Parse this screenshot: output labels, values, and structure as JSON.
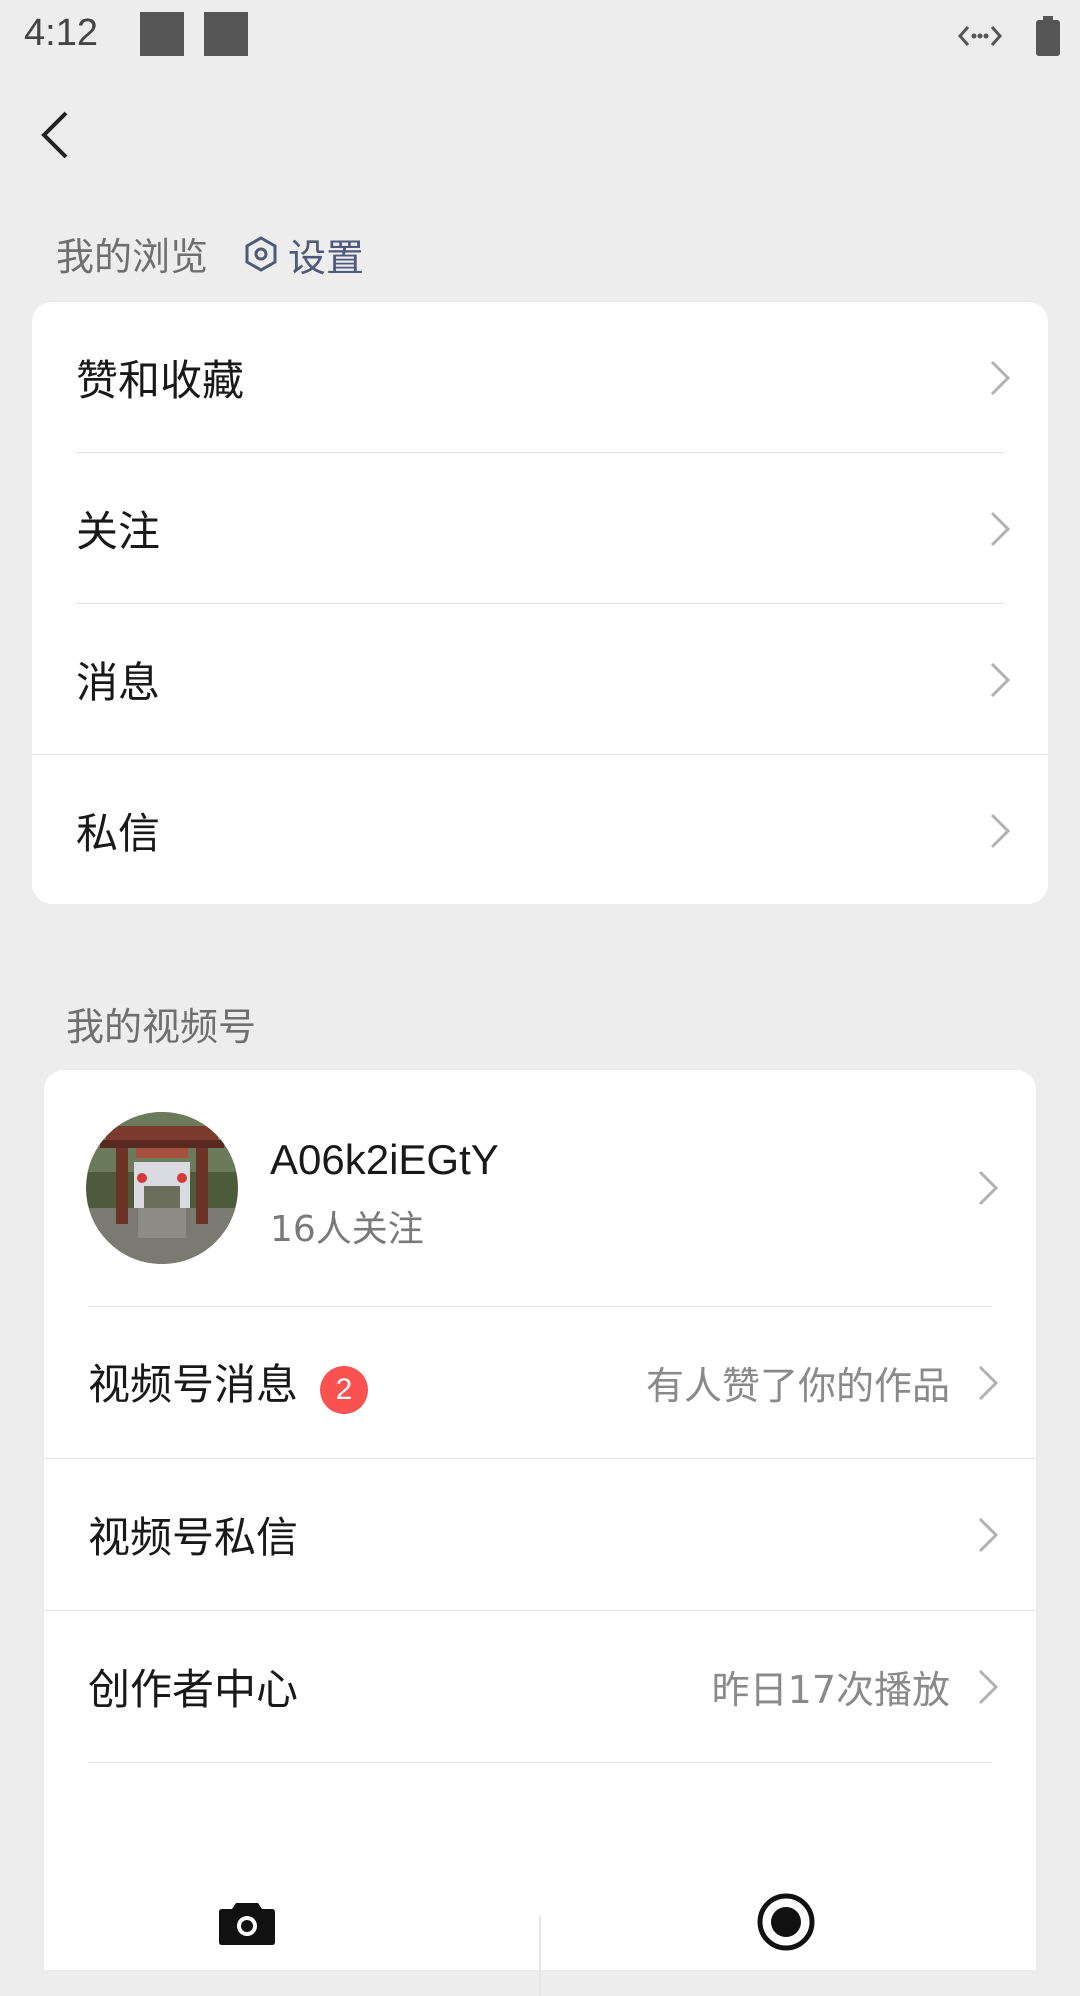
{
  "status_bar": {
    "time": "4:12"
  },
  "header": {
    "back_icon": "back-arrow-icon"
  },
  "browse_section": {
    "title": "我的浏览",
    "settings_label": "设置",
    "items": [
      {
        "label": "赞和收藏"
      },
      {
        "label": "关注"
      },
      {
        "label": "消息"
      },
      {
        "label": "私信"
      }
    ]
  },
  "channels_section": {
    "title": "我的视频号",
    "profile": {
      "name": "A06k2iEGtY",
      "followers": "16人关注"
    },
    "items": [
      {
        "label": "视频号消息",
        "badge": "2",
        "detail": "有人赞了你的作品"
      },
      {
        "label": "视频号私信",
        "detail": ""
      },
      {
        "label": "创作者中心",
        "detail": "昨日17次播放"
      }
    ],
    "actions": [
      "camera-icon",
      "record-icon"
    ]
  },
  "colors": {
    "background": "#ededed",
    "badge": "#fa5151",
    "settings_link": "#4f5a7a"
  }
}
